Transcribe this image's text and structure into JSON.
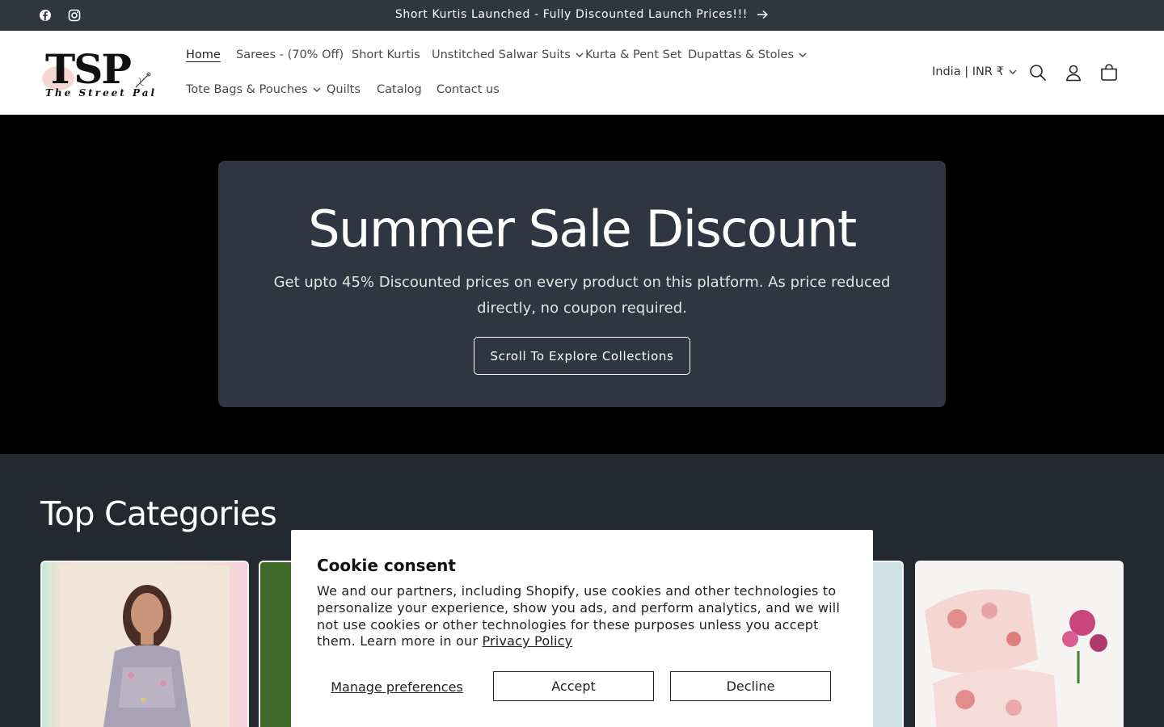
{
  "announcement": {
    "message": "Short Kurtis Launched - Fully Discounted Launch Prices!!!",
    "social": [
      "facebook-icon",
      "instagram-icon"
    ]
  },
  "header": {
    "logo_main": "TSP",
    "logo_sub": "The Street Pal",
    "nav_row1": [
      {
        "label": "Home",
        "dropdown": false,
        "active": true
      },
      {
        "label": "Sarees - (70% Off)",
        "dropdown": false
      },
      {
        "label": "Short Kurtis",
        "dropdown": false
      },
      {
        "label": "Unstitched Salwar Suits",
        "dropdown": true
      },
      {
        "label": "Kurta & Pent Set",
        "dropdown": false
      },
      {
        "label": "Dupattas & Stoles",
        "dropdown": true
      }
    ],
    "nav_row2": [
      {
        "label": "Tote Bags & Pouches",
        "dropdown": true
      },
      {
        "label": "Quilts",
        "dropdown": false
      },
      {
        "label": "Catalog",
        "dropdown": false
      },
      {
        "label": "Contact us",
        "dropdown": false
      }
    ],
    "country": "India | INR ₹",
    "icons": [
      "search-icon",
      "account-icon",
      "cart-icon"
    ]
  },
  "hero": {
    "title": "Summer Sale Discount",
    "text": "Get upto 45% Discounted prices on every product on this platform. As price reduced directly, no coupon required.",
    "button": "Scroll To Explore Collections"
  },
  "categories": {
    "title": "Top Categories"
  },
  "cookie": {
    "title": "Cookie consent",
    "body": "We and our partners, including Shopify, use cookies and other technologies to personalize your experience, show you ads, and perform analytics, and we will not use cookies or other technologies for these purposes unless you accept them. Learn more in our",
    "link": "Privacy Policy",
    "manage": "Manage preferences",
    "accept": "Accept",
    "decline": "Decline"
  },
  "colors": {
    "announcement_bg": "#2f3640",
    "hero_box_bg": "#2f3541",
    "categories_bg": "#232831"
  }
}
